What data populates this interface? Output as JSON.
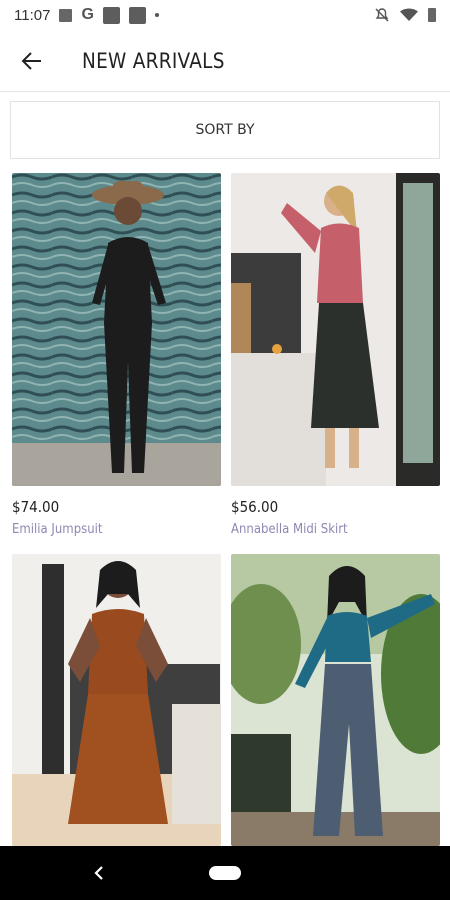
{
  "status_bar": {
    "time": "11:07",
    "google_glyph": "G",
    "icons": [
      "image-icon",
      "google-icon",
      "app-icon",
      "app-icon",
      "dot-icon",
      "mute-icon",
      "wifi-icon",
      "battery-icon"
    ]
  },
  "app_bar": {
    "title": "NEW ARRIVALS",
    "back_icon": "arrow-left-icon"
  },
  "sort": {
    "label": "SORT BY"
  },
  "products": [
    {
      "price": "$74.00",
      "name": "Emilia Jumpsuit",
      "image": "woman in black jumpsuit and hat against blue wood wall"
    },
    {
      "price": "$56.00",
      "name": "Annabella Midi Skirt",
      "image": "woman in pink top and dark wrap midi skirt"
    },
    {
      "price": "",
      "name": "",
      "image": "woman in rust midi dress"
    },
    {
      "price": "",
      "name": "",
      "image": "woman in teal crop top and patterned wide pants"
    }
  ],
  "nav_bar": {
    "back_icon": "nav-back-icon",
    "home_icon": "home-pill-icon"
  },
  "colors": {
    "product_name": "#8d88b3",
    "nav_bar": "#000000"
  }
}
